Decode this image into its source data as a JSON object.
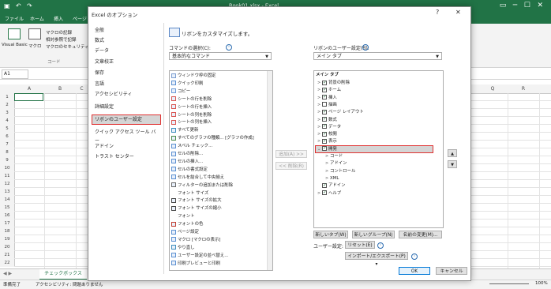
{
  "excel": {
    "title": "Book01.xlsx - Excel",
    "tabs": [
      "ファイル",
      "ホーム",
      "挿入",
      "ページ"
    ],
    "ribbon": {
      "visual_basic": "Visual Basic",
      "macro": "マクロ",
      "record_macro": "マクロの記録",
      "relative_ref": "相対参照で記録",
      "macro_security": "マクロのセキュリティ",
      "group_label": "コード"
    },
    "name_box": "A1",
    "columns": [
      "A",
      "B",
      "C",
      "P",
      "Q",
      "R"
    ],
    "rows": [
      "1",
      "2",
      "3",
      "4",
      "5",
      "6",
      "7",
      "8",
      "9",
      "10",
      "11",
      "12",
      "13",
      "14",
      "15",
      "16",
      "17",
      "18",
      "19",
      "20",
      "21",
      "22"
    ],
    "sheet_tab": "チェックボックス",
    "status_ready": "準備完了",
    "status_accessibility": "アクセシビリティ: 問題ありません",
    "zoom": "100%"
  },
  "dialog": {
    "title": "Excel のオプション",
    "help": "?",
    "close": "✕",
    "nav": [
      "全般",
      "数式",
      "データ",
      "文章校正",
      "保存",
      "言語",
      "アクセシビリティ",
      "詳細設定",
      "リボンのユーザー設定",
      "クイック アクセス ツール バー",
      "アドイン",
      "トラスト センター"
    ],
    "header": "リボンをカスタマイズします。",
    "commands_label": "コマンドの選択(C):",
    "commands_value": "基本的なコマンド",
    "ribbon_label": "リボンのユーザー設定(B):",
    "ribbon_value": "メイン タブ",
    "commands": [
      "ウィンドウ枠の固定",
      "クイック印刷",
      "コピー",
      "シートの行を削除",
      "シートの行を挿入",
      "シートの列を削除",
      "シートの列を挿入",
      "すべて更新",
      "すべてのグラフの種類... [グラフの作成]",
      "スペル チェック...",
      "セルの削除...",
      "セルの挿入...",
      "セルの書式設定",
      "セルを結合して中央揃え",
      "フィルターの追加または削除",
      "フォント サイズ",
      "フォント サイズの拡大",
      "フォント サイズの縮小",
      "フォント",
      "フォントの色",
      "ページ設定",
      "マクロ [マクロの表示]",
      "やり直し",
      "ユーザー設定の並べ替え...",
      "印刷プレビューと印刷"
    ],
    "add_button": "追加(A) >>",
    "remove_button": "<< 削除(R)",
    "tree_header": "メイン タブ",
    "tree": [
      "背景の削除",
      "ホーム",
      "挿入",
      "描画",
      "ページ レイアウト",
      "数式",
      "データ",
      "校閲",
      "表示",
      "開発",
      "コード",
      "アドイン",
      "コントロール",
      "XML",
      "アドイン",
      "ヘルプ"
    ],
    "new_tab": "新しいタブ(W)",
    "new_group": "新しいグループ(N)",
    "rename": "名前の変更(M)...",
    "user_settings_label": "ユーザー設定:",
    "reset": "リセット(E) ▾",
    "import_export": "インポート/エクスポート(P) ▾",
    "ok": "OK",
    "cancel": "キャンセル",
    "up_arrow": "▲",
    "down_arrow": "▼"
  }
}
